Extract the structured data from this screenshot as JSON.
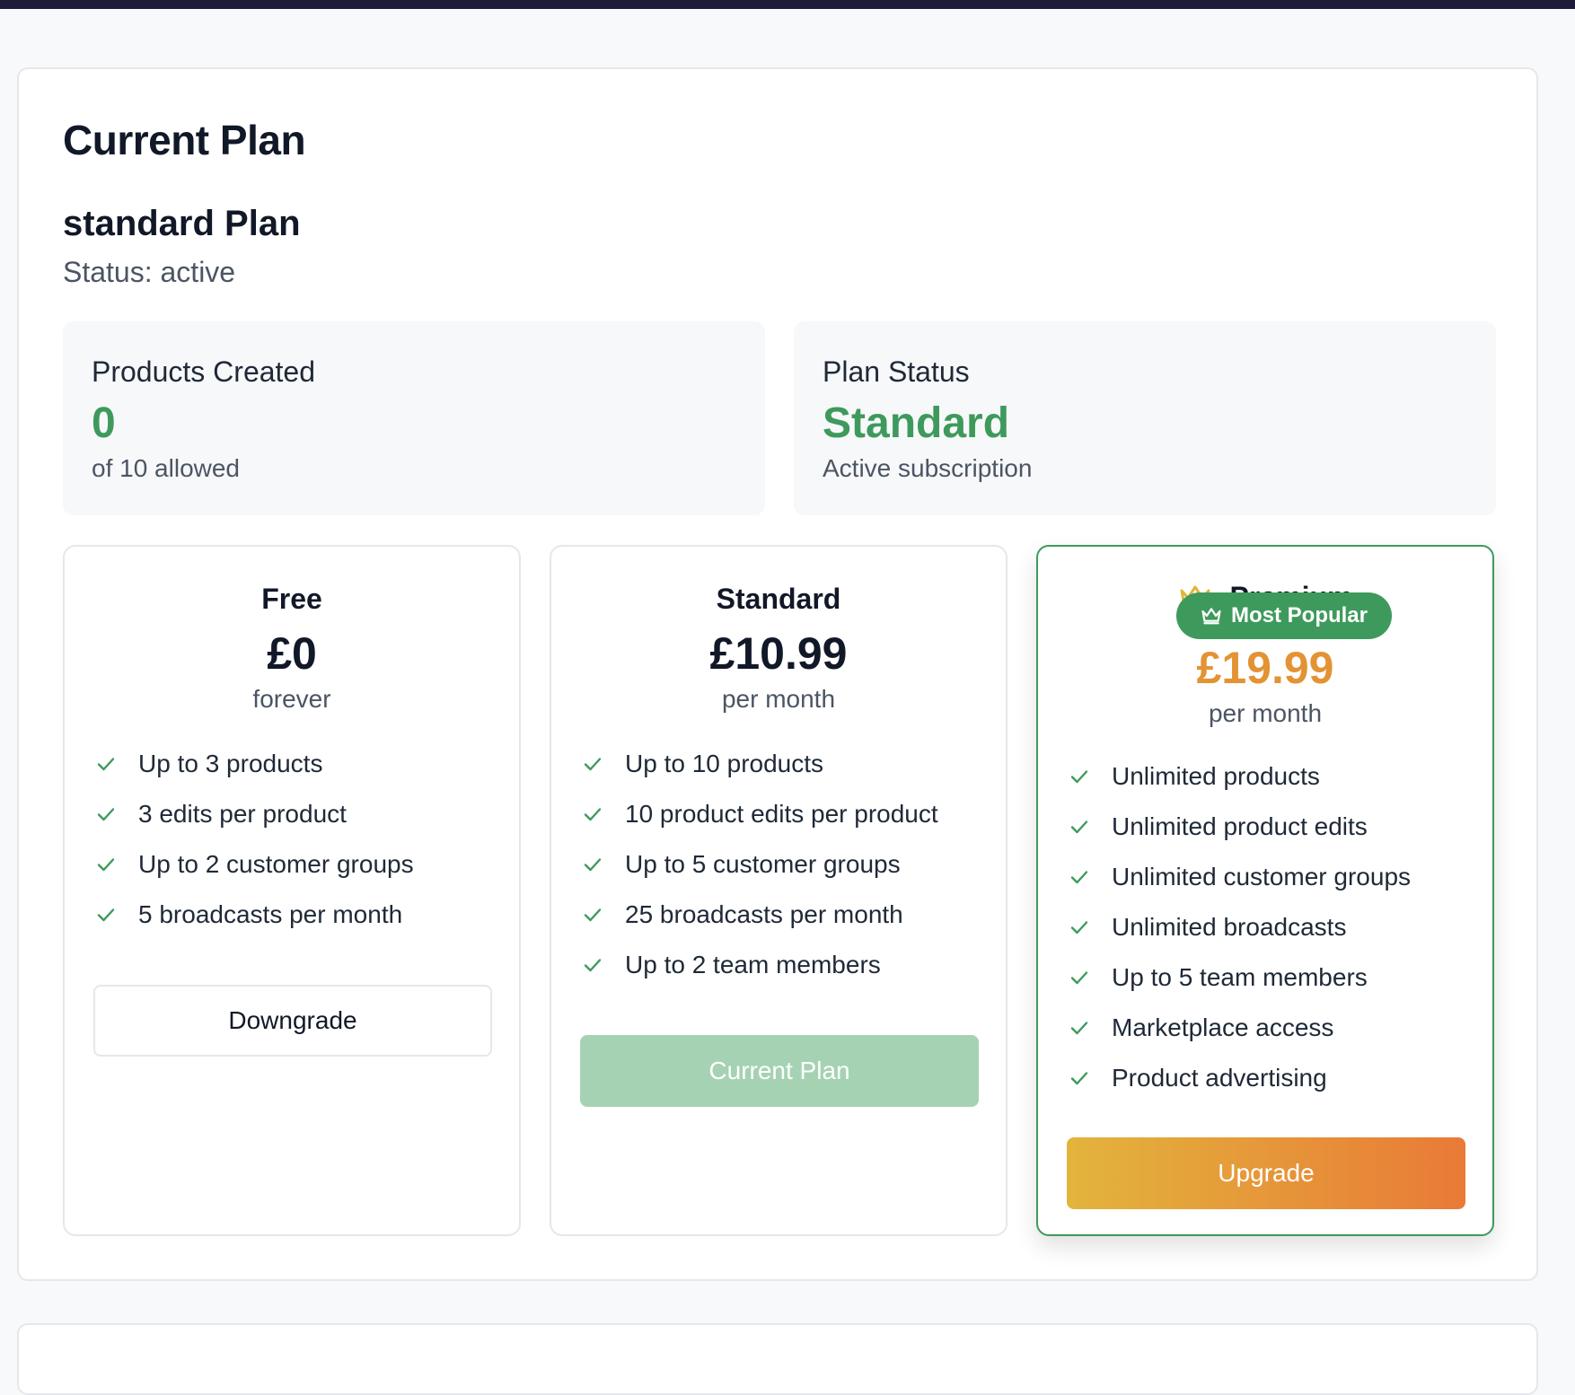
{
  "page": {
    "title": "Current Plan",
    "plan_name": "standard Plan",
    "status_text": "Status: active"
  },
  "stats": {
    "products": {
      "label": "Products Created",
      "value": "0",
      "sub": "of 10 allowed"
    },
    "plan_status": {
      "label": "Plan Status",
      "value": "Standard",
      "sub": "Active subscription"
    }
  },
  "tiers": {
    "free": {
      "name": "Free",
      "price": "£0",
      "period": "forever",
      "features": [
        "Up to 3 products",
        "3 edits per product",
        "Up to 2 customer groups",
        "5 broadcasts per month"
      ],
      "button": "Downgrade"
    },
    "standard": {
      "name": "Standard",
      "price": "£10.99",
      "period": "per month",
      "features": [
        "Up to 10 products",
        "10 product edits per product",
        "Up to 5 customer groups",
        "25 broadcasts per month",
        "Up to 2 team members"
      ],
      "button": "Current Plan"
    },
    "premium": {
      "badge": "Most Popular",
      "name": "Premium",
      "price": "£19.99",
      "period": "per month",
      "features": [
        "Unlimited products",
        "Unlimited product edits",
        "Unlimited customer groups",
        "Unlimited broadcasts",
        "Up to 5 team members",
        "Marketplace access",
        "Product advertising"
      ],
      "button": "Upgrade"
    }
  },
  "icons": {
    "feature": "check-icon",
    "badge": "crown-icon",
    "premium_title": "crown-icon"
  },
  "colors": {
    "accent_green": "#3e9a5c",
    "current_plan_button": "#a5d2b3",
    "premium_price": "#e39334",
    "upgrade_gradient_start": "#e3b43c",
    "upgrade_gradient_end": "#e97a37",
    "crown": "#e3b43c"
  }
}
